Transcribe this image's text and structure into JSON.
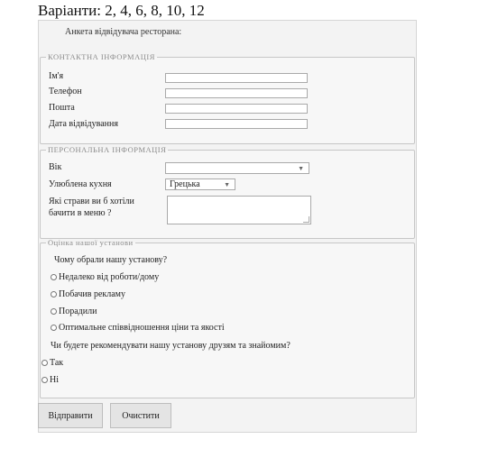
{
  "header": {
    "variants": "Варіанти: 2, 4, 6, 8, 10, 12"
  },
  "form": {
    "title": "Анкета відвідувача ресторана:"
  },
  "contact": {
    "legend": "КОНТАКТНА ІНФОРМАЦІЯ",
    "name_label": "Ім'я",
    "phone_label": "Телефон",
    "email_label": "Пошта",
    "visit_date_label": "Дата відвідування"
  },
  "personal": {
    "legend": "ПЕРСОНАЛЬНА ІНФОРМАЦІЯ",
    "age_label": "Вік",
    "cuisine_label": "Улюблена кухня",
    "cuisine_value": "Грецька",
    "dishes_label_line1": "Які страви ви б хотіли",
    "dishes_label_line2": "бачити в меню ?"
  },
  "rating": {
    "legend": "Оцінка нашої установи",
    "q1": "Чому обрали нашу установу?",
    "options": [
      "Недалеко від роботи/дому",
      "Побачив рекламу",
      "Порадили",
      "Оптимальне співвідношення ціни та якості"
    ],
    "q2": "Чи будете рекомендувати нашу установу друзям та знайомим?",
    "yes": "Так",
    "no": "Ні"
  },
  "buttons": {
    "submit": "Відправити",
    "clear": "Очистити"
  }
}
